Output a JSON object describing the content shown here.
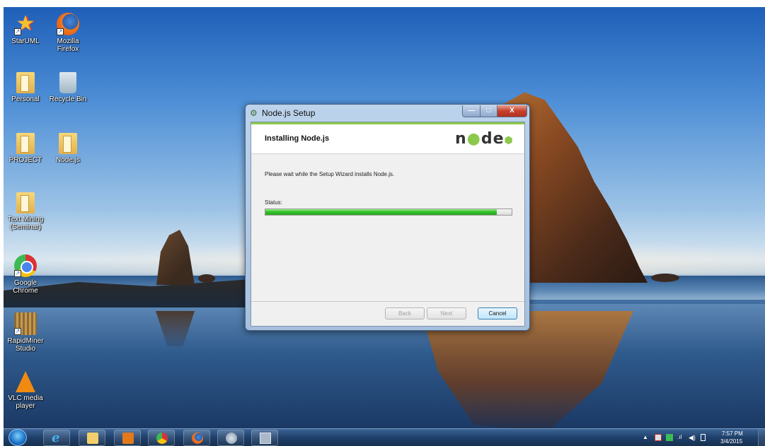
{
  "desktop": {
    "icons": [
      {
        "label": "StarUML"
      },
      {
        "label": "Mozilla\nFirefox"
      },
      {
        "label": "Personal"
      },
      {
        "label": "Recycle Bin"
      },
      {
        "label": "PROJECT"
      },
      {
        "label": "Node.js"
      },
      {
        "label": "Text Mining\n(Seminar)"
      },
      {
        "label": "Google\nChrome"
      },
      {
        "label": "RapidMiner\nStudio"
      },
      {
        "label": "VLC media\nplayer"
      }
    ]
  },
  "dialog": {
    "title": "Node.js Setup",
    "header_title": "Installing Node.js",
    "logo": {
      "n": "n",
      "o": "●",
      "de": "de",
      "hex": "⬢"
    },
    "message": "Please wait while the Setup Wizard installs Node.js.",
    "status_label": "Status:",
    "progress_percent": 94,
    "buttons": {
      "back": "Back",
      "next": "Next",
      "cancel": "Cancel"
    },
    "window_buttons": {
      "minimize": "—",
      "maximize": "□",
      "close": "X"
    }
  },
  "taskbar": {
    "ie_glyph": "e",
    "tray_arrow": "▲",
    "tray_signal": ".ıl",
    "tray_volume": "◀)",
    "clock_time": "7:57 PM",
    "clock_date": "3/4/2015"
  },
  "colors": {
    "node_green": "#8cc84b",
    "progress_green": "#33c02a",
    "taskbar": "#1f3f6a"
  }
}
